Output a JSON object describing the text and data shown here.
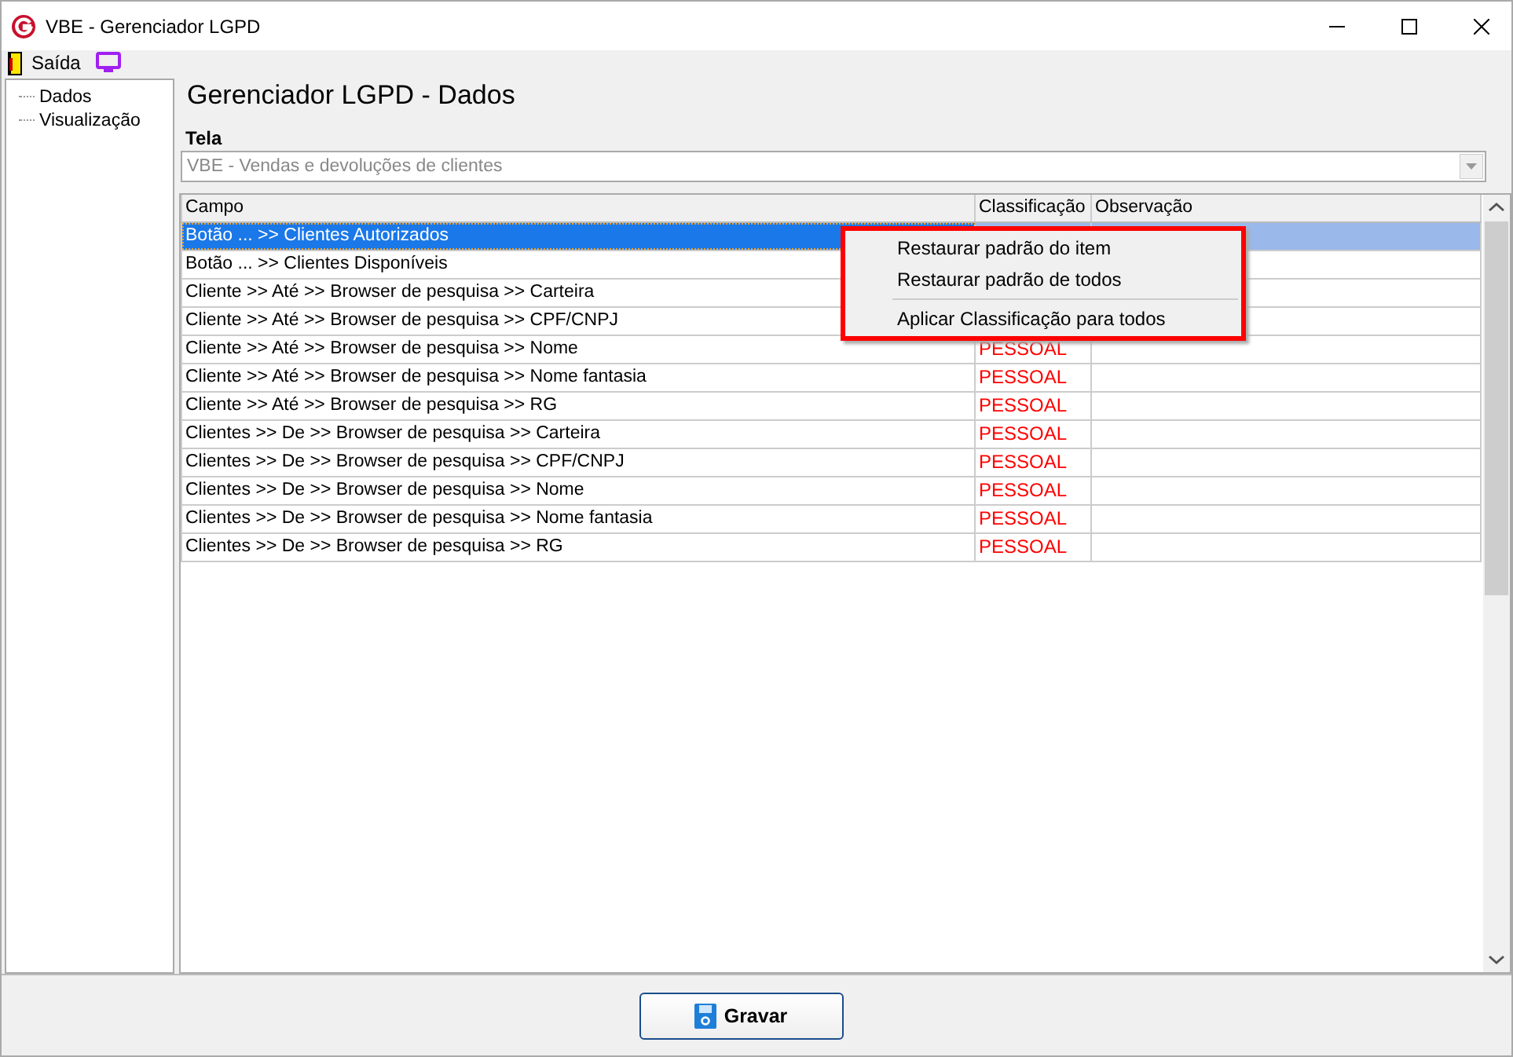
{
  "window": {
    "title": "VBE - Gerenciador LGPD"
  },
  "toolbar": {
    "items": [
      {
        "label": "Saída",
        "kind": "door"
      },
      {
        "kind": "monitor"
      }
    ]
  },
  "sidebar": {
    "items": [
      {
        "label": "Dados"
      },
      {
        "label": "Visualização"
      }
    ]
  },
  "heading": "Gerenciador LGPD - Dados",
  "tela": {
    "label": "Tela",
    "value": "VBE - Vendas e devoluções de clientes"
  },
  "table": {
    "columns": [
      "Campo",
      "Classificação",
      "Observação"
    ],
    "rows": [
      {
        "campo": "Botão ... >> Clientes Autorizados",
        "selected": true
      },
      {
        "campo": "Botão ... >> Clientes Disponíveis",
        "selected": false
      },
      {
        "campo": "Cliente >> Até >> Browser de pesquisa >> Carteira",
        "selected": false
      },
      {
        "campo": "Cliente >> Até >> Browser de pesquisa >> CPF/CNPJ",
        "selected": false
      },
      {
        "campo": "Cliente >> Até >> Browser de pesquisa >> Nome",
        "classificacao": "PESSOAL",
        "selected": false
      },
      {
        "campo": "Cliente >> Até >> Browser de pesquisa >> Nome fantasia",
        "classificacao": "PESSOAL",
        "selected": false
      },
      {
        "campo": "Cliente >> Até >> Browser de pesquisa >> RG",
        "classificacao": "PESSOAL",
        "selected": false
      },
      {
        "campo": "Clientes >> De >> Browser de pesquisa >> Carteira",
        "classificacao": "PESSOAL",
        "selected": false
      },
      {
        "campo": "Clientes >> De >> Browser de pesquisa >> CPF/CNPJ",
        "classificacao": "PESSOAL",
        "selected": false
      },
      {
        "campo": "Clientes >> De >> Browser de pesquisa >> Nome",
        "classificacao": "PESSOAL",
        "selected": false
      },
      {
        "campo": "Clientes >> De >> Browser de pesquisa >> Nome fantasia",
        "classificacao": "PESSOAL",
        "selected": false
      },
      {
        "campo": "Clientes >> De >> Browser de pesquisa >> RG",
        "classificacao": "PESSOAL",
        "selected": false
      }
    ]
  },
  "context_menu": {
    "items": [
      {
        "label": "Restaurar padrão do item",
        "kind": "item"
      },
      {
        "label": "Restaurar padrão de todos",
        "kind": "item"
      },
      {
        "kind": "separator"
      },
      {
        "label": "Aplicar Classificação para todos",
        "kind": "item"
      }
    ]
  },
  "buttons": [
    {
      "label": "Gravar"
    }
  ]
}
